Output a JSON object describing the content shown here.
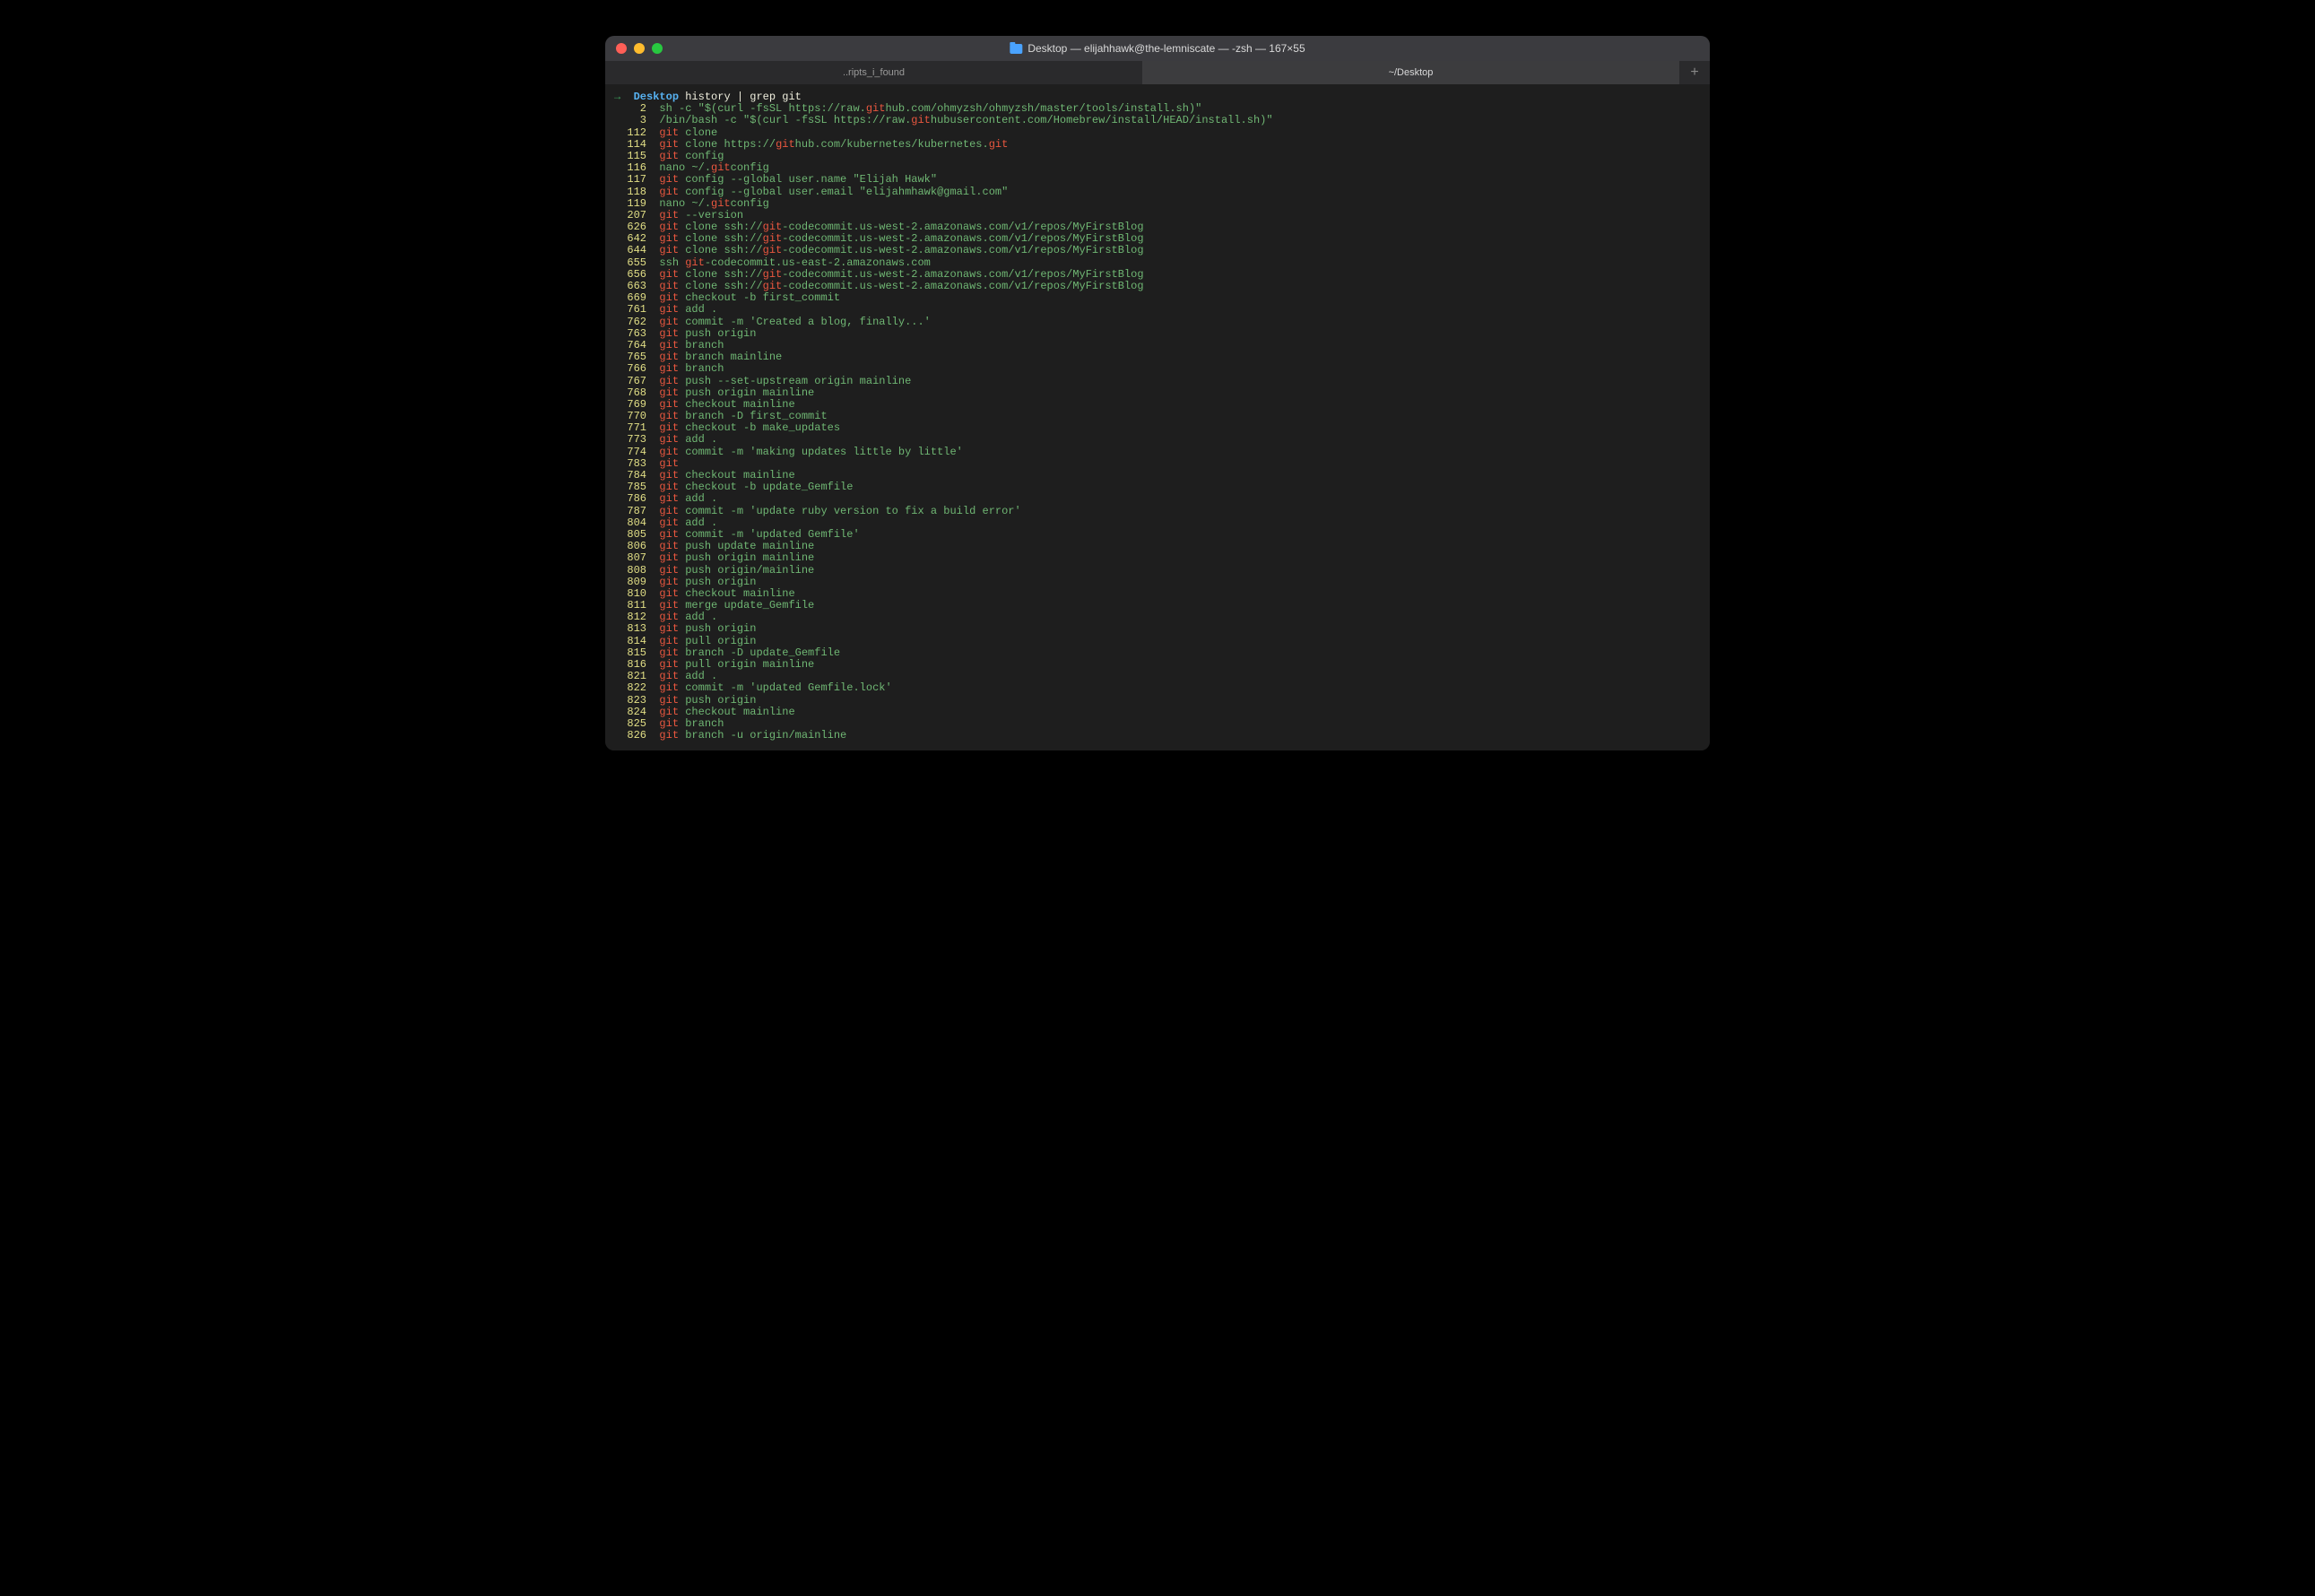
{
  "window": {
    "title": "Desktop — elijahhawk@the-lemniscate — -zsh — 167×55"
  },
  "tabs": {
    "inactive": "..ripts_i_found",
    "active": "~/Desktop",
    "add": "+"
  },
  "prompt": {
    "arrow": "→",
    "dir": "Desktop",
    "command": "history | grep git"
  },
  "highlight": "git",
  "history": [
    {
      "n": "2",
      "pre": "sh -c \"$(curl -fsSL https://raw.",
      "post": "hub.com/ohmyzsh/ohmyzsh/master/tools/install.sh)\""
    },
    {
      "n": "3",
      "pre": "/bin/bash -c \"$(curl -fsSL https://raw.",
      "post": "hubusercontent.com/Homebrew/install/HEAD/install.sh)\""
    },
    {
      "n": "112",
      "pre": "",
      "post": " clone"
    },
    {
      "n": "114",
      "segs": [
        "",
        " clone https://",
        "hub.com/kubernetes/kubernetes.",
        ""
      ]
    },
    {
      "n": "115",
      "pre": "",
      "post": " config"
    },
    {
      "n": "116",
      "pre": "nano ~/.",
      "post": "config"
    },
    {
      "n": "117",
      "pre": "",
      "post": " config --global user.name \"Elijah Hawk\""
    },
    {
      "n": "118",
      "pre": "",
      "post": " config --global user.email \"elijahmhawk@gmail.com\""
    },
    {
      "n": "119",
      "pre": "nano ~/.",
      "post": "config"
    },
    {
      "n": "207",
      "pre": "",
      "post": " --version"
    },
    {
      "n": "626",
      "segs": [
        "",
        " clone ssh://",
        "-codecommit.us-west-2.amazonaws.com/v1/repos/MyFirstBlog"
      ]
    },
    {
      "n": "642",
      "segs": [
        "",
        " clone ssh://",
        "-codecommit.us-west-2.amazonaws.com/v1/repos/MyFirstBlog"
      ]
    },
    {
      "n": "644",
      "segs": [
        "",
        " clone ssh://",
        "-codecommit.us-west-2.amazonaws.com/v1/repos/MyFirstBlog"
      ]
    },
    {
      "n": "655",
      "pre": "ssh ",
      "post": "-codecommit.us-east-2.amazonaws.com"
    },
    {
      "n": "656",
      "segs": [
        "",
        " clone ssh://",
        "-codecommit.us-west-2.amazonaws.com/v1/repos/MyFirstBlog"
      ]
    },
    {
      "n": "663",
      "segs": [
        "",
        " clone ssh://",
        "-codecommit.us-west-2.amazonaws.com/v1/repos/MyFirstBlog"
      ]
    },
    {
      "n": "669",
      "pre": "",
      "post": " checkout -b first_commit"
    },
    {
      "n": "761",
      "pre": "",
      "post": " add ."
    },
    {
      "n": "762",
      "pre": "",
      "post": " commit -m 'Created a blog, finally...'"
    },
    {
      "n": "763",
      "pre": "",
      "post": " push origin"
    },
    {
      "n": "764",
      "pre": "",
      "post": " branch"
    },
    {
      "n": "765",
      "pre": "",
      "post": " branch mainline"
    },
    {
      "n": "766",
      "pre": "",
      "post": " branch"
    },
    {
      "n": "767",
      "pre": "",
      "post": " push --set-upstream origin mainline"
    },
    {
      "n": "768",
      "pre": "",
      "post": " push origin mainline"
    },
    {
      "n": "769",
      "pre": "",
      "post": " checkout mainline"
    },
    {
      "n": "770",
      "pre": "",
      "post": " branch -D first_commit"
    },
    {
      "n": "771",
      "pre": "",
      "post": " checkout -b make_updates"
    },
    {
      "n": "773",
      "pre": "",
      "post": " add ."
    },
    {
      "n": "774",
      "pre": "",
      "post": " commit -m 'making updates little by little'"
    },
    {
      "n": "783",
      "pre": "",
      "post": ""
    },
    {
      "n": "784",
      "pre": "",
      "post": " checkout mainline"
    },
    {
      "n": "785",
      "pre": "",
      "post": " checkout -b update_Gemfile"
    },
    {
      "n": "786",
      "pre": "",
      "post": " add ."
    },
    {
      "n": "787",
      "pre": "",
      "post": " commit -m 'update ruby version to fix a build error'"
    },
    {
      "n": "804",
      "pre": "",
      "post": " add ."
    },
    {
      "n": "805",
      "pre": "",
      "post": " commit -m 'updated Gemfile'"
    },
    {
      "n": "806",
      "pre": "",
      "post": " push update mainline"
    },
    {
      "n": "807",
      "pre": "",
      "post": " push origin mainline"
    },
    {
      "n": "808",
      "pre": "",
      "post": " push origin/mainline"
    },
    {
      "n": "809",
      "pre": "",
      "post": " push origin"
    },
    {
      "n": "810",
      "pre": "",
      "post": " checkout mainline"
    },
    {
      "n": "811",
      "pre": "",
      "post": " merge update_Gemfile"
    },
    {
      "n": "812",
      "pre": "",
      "post": " add ."
    },
    {
      "n": "813",
      "pre": "",
      "post": " push origin"
    },
    {
      "n": "814",
      "pre": "",
      "post": " pull origin"
    },
    {
      "n": "815",
      "pre": "",
      "post": " branch -D update_Gemfile"
    },
    {
      "n": "816",
      "pre": "",
      "post": " pull origin mainline"
    },
    {
      "n": "821",
      "pre": "",
      "post": " add ."
    },
    {
      "n": "822",
      "pre": "",
      "post": " commit -m 'updated Gemfile.lock'"
    },
    {
      "n": "823",
      "pre": "",
      "post": " push origin"
    },
    {
      "n": "824",
      "pre": "",
      "post": " checkout mainline"
    },
    {
      "n": "825",
      "pre": "",
      "post": " branch"
    },
    {
      "n": "826",
      "pre": "",
      "post": " branch -u origin/mainline"
    }
  ]
}
